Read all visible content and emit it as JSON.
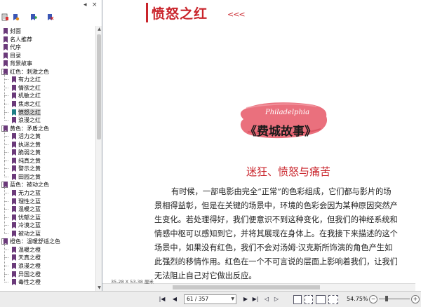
{
  "pane": {
    "close_glyph": "×",
    "collapse_glyph": "◂"
  },
  "bookmarks": [
    {
      "label": "封面",
      "level": 0
    },
    {
      "label": "名人推荐",
      "level": 0
    },
    {
      "label": "代序",
      "level": 0
    },
    {
      "label": "目录",
      "level": 0
    },
    {
      "label": "背景故事",
      "level": 0
    },
    {
      "label": "红色：刺激之色",
      "level": 0,
      "expanded": true
    },
    {
      "label": "有力之红",
      "level": 1
    },
    {
      "label": "情欲之红",
      "level": 1
    },
    {
      "label": "机敏之红",
      "level": 1
    },
    {
      "label": "焦虑之红",
      "level": 1
    },
    {
      "label": "愤怒之红",
      "level": 1,
      "selected": true
    },
    {
      "label": "浪漫之红",
      "level": 1
    },
    {
      "label": "黄色：矛盾之色",
      "level": 0,
      "expanded": true
    },
    {
      "label": "活力之黄",
      "level": 1
    },
    {
      "label": "执迷之黄",
      "level": 1
    },
    {
      "label": "脆弱之黄",
      "level": 1
    },
    {
      "label": "纯真之黄",
      "level": 1
    },
    {
      "label": "警示之黄",
      "level": 1
    },
    {
      "label": "田园之黄",
      "level": 1
    },
    {
      "label": "蓝色：被动之色",
      "level": 0,
      "expanded": true
    },
    {
      "label": "无力之蓝",
      "level": 1
    },
    {
      "label": "理性之蓝",
      "level": 1
    },
    {
      "label": "温暖之蓝",
      "level": 1
    },
    {
      "label": "忧郁之蓝",
      "level": 1
    },
    {
      "label": "冷漠之蓝",
      "level": 1
    },
    {
      "label": "被动之蓝",
      "level": 1
    },
    {
      "label": "橙色：温暖舒适之色",
      "level": 0,
      "expanded": true
    },
    {
      "label": "温暖之橙",
      "level": 1
    },
    {
      "label": "天真之橙",
      "level": 1
    },
    {
      "label": "浪漫之橙",
      "level": 1
    },
    {
      "label": "异国之橙",
      "level": 1
    },
    {
      "label": "毒性之橙",
      "level": 1
    }
  ],
  "document": {
    "chapter_title": "愤怒之红",
    "chevrons": "<<<",
    "banner_en": "Philadelphia",
    "banner_cn": "《费城故事》",
    "section_title": "迷狂、愤怒与痛苦",
    "paragraph_lines": [
      "有时候，一部电影由完全“正常”的色彩组成，它们都与影片的场",
      "景相得益彰，但是在关键的场景中，环境的色彩会因为某种原因突然产",
      "生变化。若处理得好，我们便意识不到这种变化，但我们的神经系统和",
      "情感中枢可以感知到它，并将其展现在身体上。在我接下来描述的这个",
      "场景中，如果没有红色，我们不会对汤姆·汉克斯所饰演的角色产生如",
      "此强烈的移情作用。红色在一个不可言说的层面上影响着我们，让我们",
      "无法阻止自己对它做出反应。"
    ],
    "page_size": "35.28 X 53.38 厘米"
  },
  "statusbar": {
    "page_value": "61 / 357",
    "zoom": "54.75%",
    "zoom_minus": "−",
    "zoom_plus": "+"
  },
  "colors": {
    "accent_red": "#c9242b",
    "bookmark_purple": "#6b3a7a",
    "bookmark_teal": "#1d7f86",
    "brush_pink": "#e86472"
  }
}
